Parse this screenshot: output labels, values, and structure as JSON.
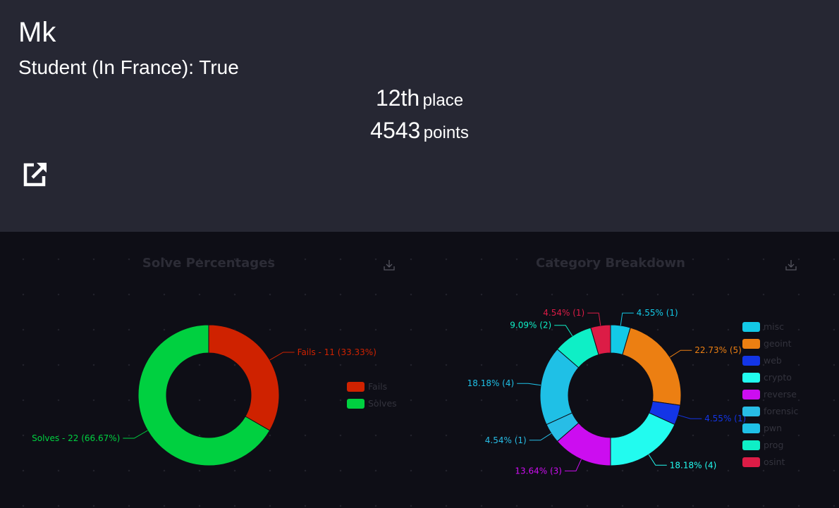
{
  "team": {
    "name": "Mk",
    "student_line": "Student (In France): True",
    "place_value": "12th",
    "place_unit": "place",
    "points_value": "4543",
    "points_unit": "points",
    "link_icon": "external-link-icon"
  },
  "charts_section": {
    "solve_title": "Solve Percentages",
    "category_title": "Category Breakdown",
    "download_icon": "download-icon"
  },
  "chart_data": [
    {
      "type": "pie",
      "style": "donut",
      "title": "Solve Percentages",
      "legend_position": "right",
      "slices": [
        {
          "name": "Fails",
          "value": 11,
          "label": "Fails - 11 (33.33%)",
          "color": "#cf2200"
        },
        {
          "name": "Solves",
          "value": 22,
          "label": "Solves - 22 (66.67%)",
          "color": "#00d040"
        }
      ]
    },
    {
      "type": "pie",
      "style": "donut",
      "title": "Category Breakdown",
      "legend_position": "right",
      "slices": [
        {
          "name": "misc",
          "value": 1,
          "label": "4.55% (1)",
          "color": "#13c9e6"
        },
        {
          "name": "geoint",
          "value": 5,
          "label": "22.73% (5)",
          "color": "#ec7f12"
        },
        {
          "name": "web",
          "value": 1,
          "label": "4.55% (1)",
          "color": "#1335e6"
        },
        {
          "name": "crypto",
          "value": 4,
          "label": "18.18% (4)",
          "color": "#22fbef"
        },
        {
          "name": "reverse",
          "value": 3,
          "label": "13.64% (3)",
          "color": "#cc0df0"
        },
        {
          "name": "forensic",
          "value": 1,
          "label": "4.54% (1)",
          "color": "#28bde6"
        },
        {
          "name": "pwn",
          "value": 4,
          "label": "18.18% (4)",
          "color": "#1fc0e6"
        },
        {
          "name": "prog",
          "value": 2,
          "label": "9.09% (2)",
          "color": "#0eefc6"
        },
        {
          "name": "osint",
          "value": 1,
          "label": "4.54% (1)",
          "color": "#dc1c46"
        }
      ]
    }
  ]
}
